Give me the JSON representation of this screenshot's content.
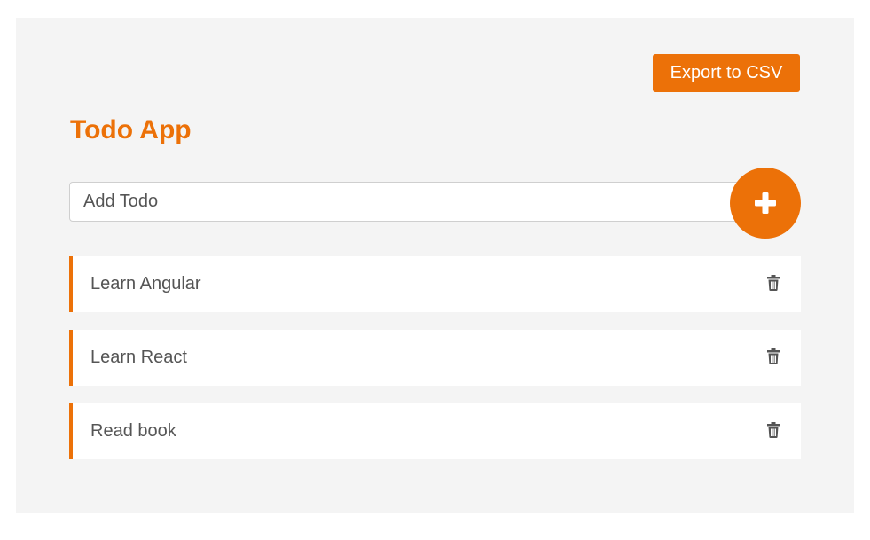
{
  "header": {
    "export_label": "Export to CSV",
    "title": "Todo App"
  },
  "input": {
    "placeholder": "Add Todo",
    "value": ""
  },
  "add_button": {
    "icon": "plus-icon"
  },
  "todos": [
    {
      "text": "Learn Angular",
      "action_icon": "trash-icon"
    },
    {
      "text": "Learn React",
      "action_icon": "trash-icon"
    },
    {
      "text": "Read book",
      "action_icon": "trash-icon"
    }
  ],
  "colors": {
    "accent": "#ec7108",
    "background": "#f4f4f4",
    "text": "#555555",
    "icon": "#555555"
  }
}
